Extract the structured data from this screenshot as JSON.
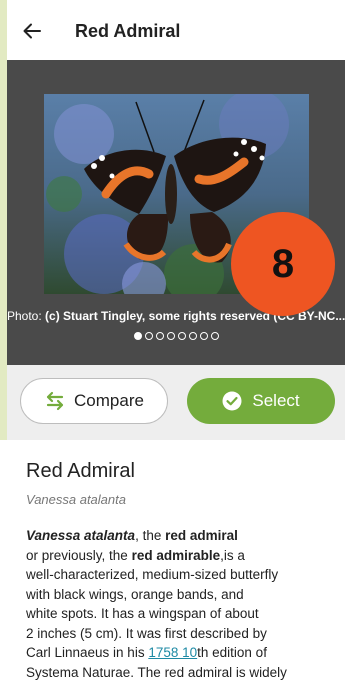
{
  "appbar": {
    "title": "Red Admiral",
    "back_icon": "arrow-left-icon"
  },
  "photo": {
    "caption_prefix": "Photo: ",
    "caption_credit": "(c) Stuart Tingley, some rights reserved (CC BY-NC...",
    "pager": {
      "count": 8,
      "active": 0
    }
  },
  "badge": {
    "value": "8",
    "color": "#ee5522"
  },
  "buttons": {
    "compare_label": "Compare",
    "compare_icon": "swap-arrows-icon",
    "select_label": "Select",
    "select_icon": "check-circle-icon",
    "accent": "#74ac3c"
  },
  "species": {
    "common_name": "Red Admiral",
    "scientific_name": "Vanessa atalanta",
    "description": {
      "l1_sci": "Vanessa atalanta",
      "l1_a": ", the ",
      "l1_bold": "red admiral",
      "l2_a": "or previously, the ",
      "l2_bold": "red admirable",
      "l2_b": ",is a",
      "l3": "well-characterized, medium-sized butterfly",
      "l4": "with black wings, orange bands, and",
      "l5": "white spots. It has a wingspan of about",
      "l6": "2 inches (5 cm). It was first described by",
      "l7_a": "Carl Linnaeus in his ",
      "l7_link": "1758 10",
      "l7_b": "th edition of",
      "l8": "Systema Naturae. The red admiral is widely"
    }
  }
}
